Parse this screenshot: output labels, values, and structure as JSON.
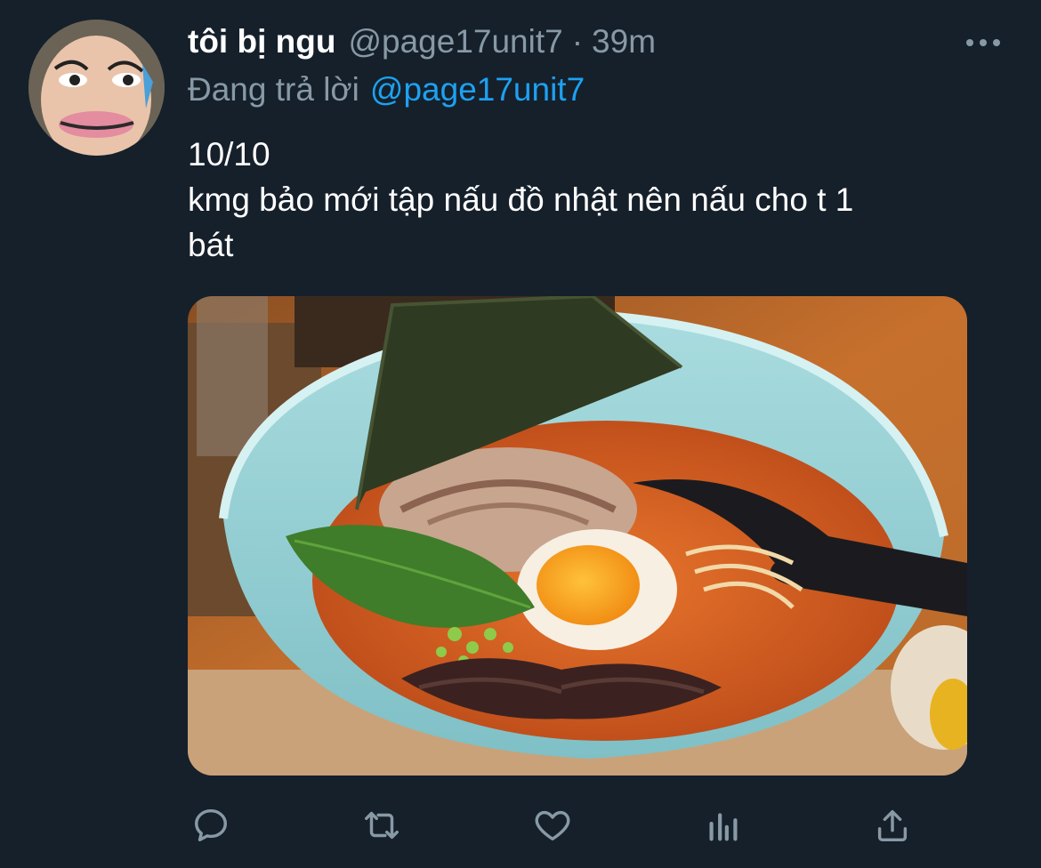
{
  "tweet": {
    "display_name": "tôi bị ngu",
    "handle": "@page17unit7",
    "separator": "·",
    "time": "39m",
    "replying_prefix": "Đang trả lời",
    "replying_to": "@page17unit7",
    "text_lines": [
      "10/10",
      "kmg bảo mới tập nấu đồ nhật nên nấu cho t 1",
      "bát"
    ]
  },
  "icons": {
    "avatar": "cartoon-face-avatar",
    "more": "more-dots-icon",
    "media": "ramen-bowl-photo",
    "reply": "reply-icon",
    "retweet": "retweet-icon",
    "like": "heart-icon",
    "analytics": "analytics-icon",
    "share": "share-icon"
  },
  "colors": {
    "background": "#15202b",
    "primary_text": "#ffffff",
    "secondary_text": "#8899a6",
    "accent": "#1da1f2"
  }
}
